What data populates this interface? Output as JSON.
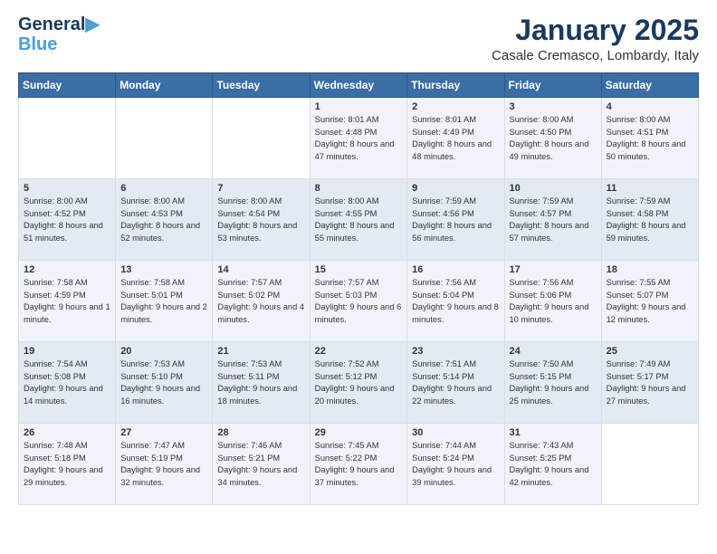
{
  "logo": {
    "line1": "General",
    "line2": "Blue"
  },
  "header": {
    "month": "January 2025",
    "location": "Casale Cremasco, Lombardy, Italy"
  },
  "weekdays": [
    "Sunday",
    "Monday",
    "Tuesday",
    "Wednesday",
    "Thursday",
    "Friday",
    "Saturday"
  ],
  "weeks": [
    [
      {
        "day": "",
        "info": ""
      },
      {
        "day": "",
        "info": ""
      },
      {
        "day": "",
        "info": ""
      },
      {
        "day": "1",
        "info": "Sunrise: 8:01 AM\nSunset: 4:48 PM\nDaylight: 8 hours and 47 minutes."
      },
      {
        "day": "2",
        "info": "Sunrise: 8:01 AM\nSunset: 4:49 PM\nDaylight: 8 hours and 48 minutes."
      },
      {
        "day": "3",
        "info": "Sunrise: 8:00 AM\nSunset: 4:50 PM\nDaylight: 8 hours and 49 minutes."
      },
      {
        "day": "4",
        "info": "Sunrise: 8:00 AM\nSunset: 4:51 PM\nDaylight: 8 hours and 50 minutes."
      }
    ],
    [
      {
        "day": "5",
        "info": "Sunrise: 8:00 AM\nSunset: 4:52 PM\nDaylight: 8 hours and 51 minutes."
      },
      {
        "day": "6",
        "info": "Sunrise: 8:00 AM\nSunset: 4:53 PM\nDaylight: 8 hours and 52 minutes."
      },
      {
        "day": "7",
        "info": "Sunrise: 8:00 AM\nSunset: 4:54 PM\nDaylight: 8 hours and 53 minutes."
      },
      {
        "day": "8",
        "info": "Sunrise: 8:00 AM\nSunset: 4:55 PM\nDaylight: 8 hours and 55 minutes."
      },
      {
        "day": "9",
        "info": "Sunrise: 7:59 AM\nSunset: 4:56 PM\nDaylight: 8 hours and 56 minutes."
      },
      {
        "day": "10",
        "info": "Sunrise: 7:59 AM\nSunset: 4:57 PM\nDaylight: 8 hours and 57 minutes."
      },
      {
        "day": "11",
        "info": "Sunrise: 7:59 AM\nSunset: 4:58 PM\nDaylight: 8 hours and 59 minutes."
      }
    ],
    [
      {
        "day": "12",
        "info": "Sunrise: 7:58 AM\nSunset: 4:59 PM\nDaylight: 9 hours and 1 minute."
      },
      {
        "day": "13",
        "info": "Sunrise: 7:58 AM\nSunset: 5:01 PM\nDaylight: 9 hours and 2 minutes."
      },
      {
        "day": "14",
        "info": "Sunrise: 7:57 AM\nSunset: 5:02 PM\nDaylight: 9 hours and 4 minutes."
      },
      {
        "day": "15",
        "info": "Sunrise: 7:57 AM\nSunset: 5:03 PM\nDaylight: 9 hours and 6 minutes."
      },
      {
        "day": "16",
        "info": "Sunrise: 7:56 AM\nSunset: 5:04 PM\nDaylight: 9 hours and 8 minutes."
      },
      {
        "day": "17",
        "info": "Sunrise: 7:56 AM\nSunset: 5:06 PM\nDaylight: 9 hours and 10 minutes."
      },
      {
        "day": "18",
        "info": "Sunrise: 7:55 AM\nSunset: 5:07 PM\nDaylight: 9 hours and 12 minutes."
      }
    ],
    [
      {
        "day": "19",
        "info": "Sunrise: 7:54 AM\nSunset: 5:08 PM\nDaylight: 9 hours and 14 minutes."
      },
      {
        "day": "20",
        "info": "Sunrise: 7:53 AM\nSunset: 5:10 PM\nDaylight: 9 hours and 16 minutes."
      },
      {
        "day": "21",
        "info": "Sunrise: 7:53 AM\nSunset: 5:11 PM\nDaylight: 9 hours and 18 minutes."
      },
      {
        "day": "22",
        "info": "Sunrise: 7:52 AM\nSunset: 5:12 PM\nDaylight: 9 hours and 20 minutes."
      },
      {
        "day": "23",
        "info": "Sunrise: 7:51 AM\nSunset: 5:14 PM\nDaylight: 9 hours and 22 minutes."
      },
      {
        "day": "24",
        "info": "Sunrise: 7:50 AM\nSunset: 5:15 PM\nDaylight: 9 hours and 25 minutes."
      },
      {
        "day": "25",
        "info": "Sunrise: 7:49 AM\nSunset: 5:17 PM\nDaylight: 9 hours and 27 minutes."
      }
    ],
    [
      {
        "day": "26",
        "info": "Sunrise: 7:48 AM\nSunset: 5:18 PM\nDaylight: 9 hours and 29 minutes."
      },
      {
        "day": "27",
        "info": "Sunrise: 7:47 AM\nSunset: 5:19 PM\nDaylight: 9 hours and 32 minutes."
      },
      {
        "day": "28",
        "info": "Sunrise: 7:46 AM\nSunset: 5:21 PM\nDaylight: 9 hours and 34 minutes."
      },
      {
        "day": "29",
        "info": "Sunrise: 7:45 AM\nSunset: 5:22 PM\nDaylight: 9 hours and 37 minutes."
      },
      {
        "day": "30",
        "info": "Sunrise: 7:44 AM\nSunset: 5:24 PM\nDaylight: 9 hours and 39 minutes."
      },
      {
        "day": "31",
        "info": "Sunrise: 7:43 AM\nSunset: 5:25 PM\nDaylight: 9 hours and 42 minutes."
      },
      {
        "day": "",
        "info": ""
      }
    ]
  ]
}
